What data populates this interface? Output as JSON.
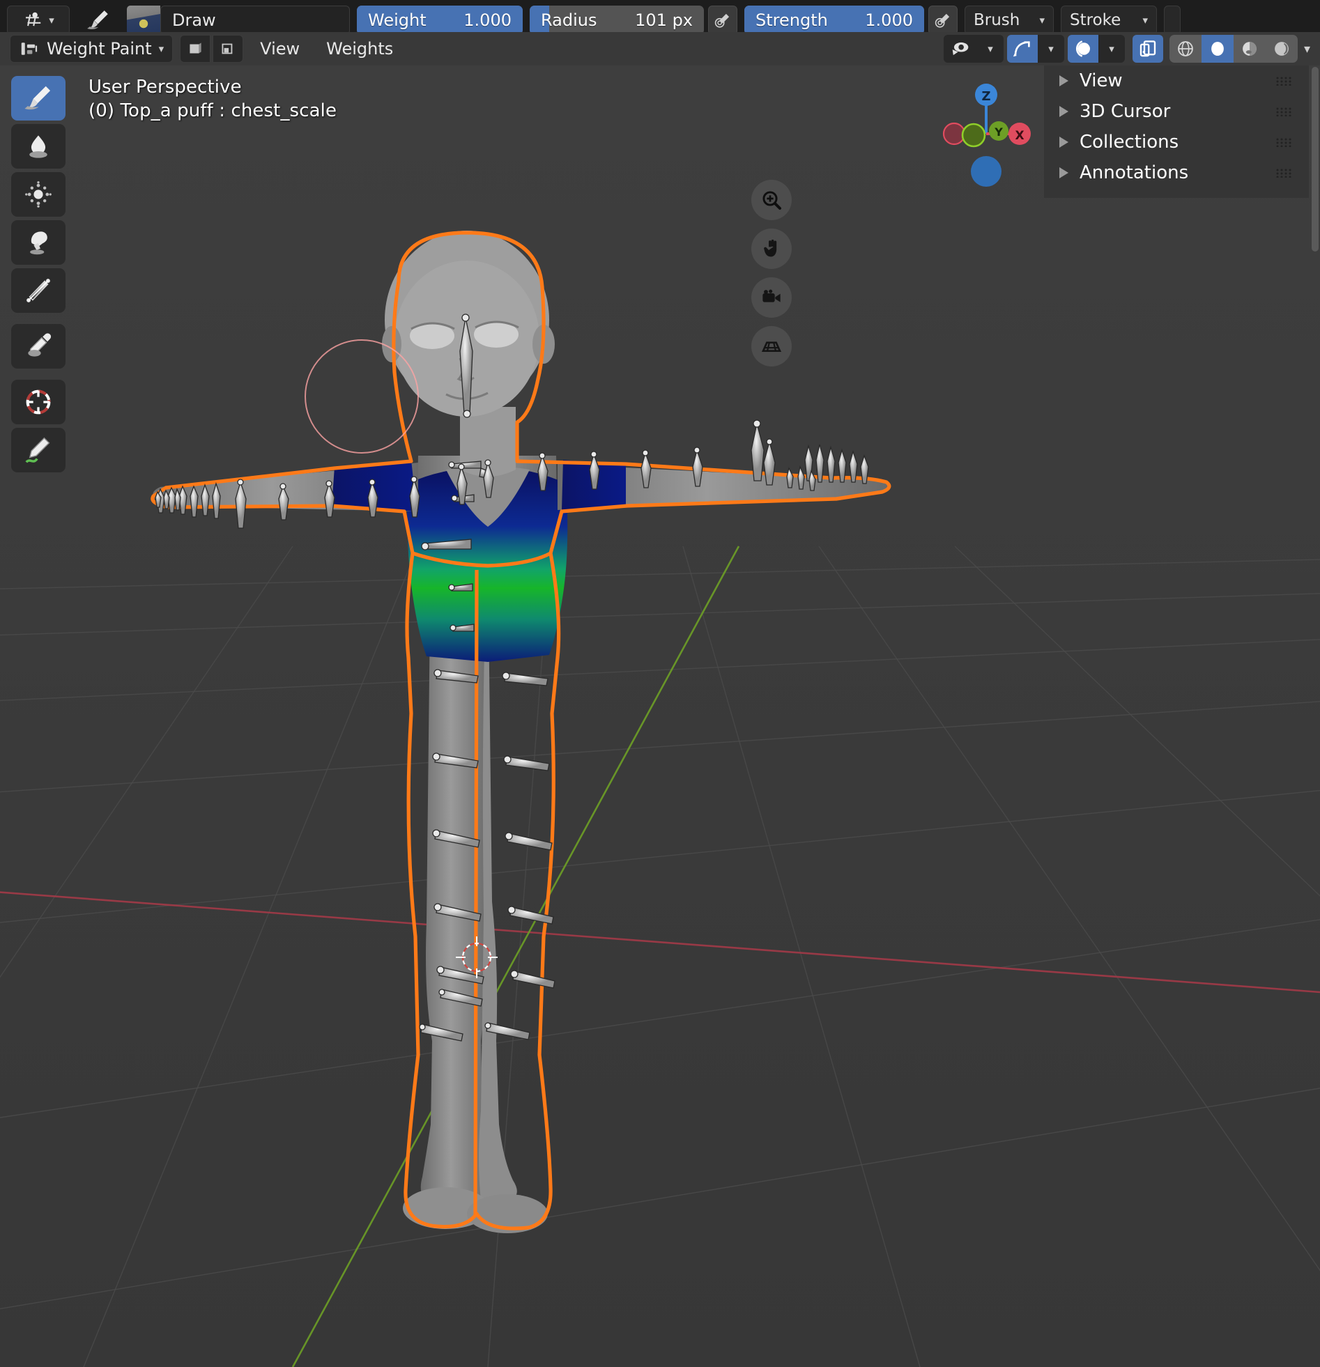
{
  "app": {
    "name": "Blender",
    "editor": "3D Viewport"
  },
  "tool_settings": {
    "falloff_icon": "brush-falloff-icon",
    "brush_icon": "brush-icon",
    "brush_preview_icon": "brush-preview-thumbnail",
    "brush_name": "Draw",
    "weight": {
      "label": "Weight",
      "value": "1.000",
      "fill_percent": 100
    },
    "radius": {
      "label": "Radius",
      "value": "101 px",
      "fill_percent": 11
    },
    "strength": {
      "label": "Strength",
      "value": "1.000",
      "fill_percent": 100
    },
    "radius_pressure_icon": "pressure-sensitivity-icon",
    "strength_pressure_icon": "pressure-sensitivity-icon",
    "brush_menu": "Brush",
    "stroke_menu": "Stroke"
  },
  "header": {
    "mode_icon": "weight-paint-mode-icon",
    "mode": "Weight Paint",
    "toggle_vertex_selection_icon": "vertex-selection-masking-icon",
    "toggle_face_selection_icon": "face-selection-masking-icon",
    "menus": [
      "View",
      "Weights"
    ],
    "right_icons": [
      {
        "name": "visibility-icon",
        "glyph": "eye",
        "active": false,
        "has_dropdown": true
      },
      {
        "name": "snap-magnet-icon",
        "glyph": "snap",
        "active": true,
        "has_dropdown": true
      },
      {
        "name": "proportional-editing-icon",
        "glyph": "proportional",
        "active": true,
        "has_dropdown": true
      },
      {
        "name": "show-overlays-icon",
        "glyph": "overlays",
        "active": true,
        "has_dropdown": false
      }
    ],
    "shading_modes": [
      {
        "name": "wireframe-shading-icon",
        "selected": false
      },
      {
        "name": "solid-shading-icon",
        "selected": true
      },
      {
        "name": "material-preview-shading-icon",
        "selected": false
      },
      {
        "name": "rendered-shading-icon",
        "selected": false
      }
    ],
    "overflow_icon": "header-overflow-chevron-icon"
  },
  "toolbar": {
    "tools": [
      {
        "name": "tool-draw",
        "label": "Draw",
        "icon": "paintbrush-icon",
        "active": true
      },
      {
        "name": "tool-blur",
        "label": "Blur",
        "icon": "droplet-icon",
        "active": false
      },
      {
        "name": "tool-average",
        "label": "Average",
        "icon": "average-dots-icon",
        "active": false
      },
      {
        "name": "tool-smear",
        "label": "Smear",
        "icon": "smear-hand-icon",
        "active": false
      },
      {
        "name": "tool-gradient",
        "label": "Gradient",
        "icon": "gradient-icon",
        "active": false
      },
      {
        "name": "tool-sample-weight",
        "label": "Sample Weight",
        "icon": "eyedropper-icon",
        "active": false
      },
      {
        "name": "tool-cursor",
        "label": "Cursor",
        "icon": "cursor-crosshair-icon",
        "active": false
      },
      {
        "name": "tool-annotate",
        "label": "Annotate",
        "icon": "annotate-pen-icon",
        "active": false
      }
    ]
  },
  "viewport": {
    "perspective_label": "User Perspective",
    "object_info": "(0) Top_a puff : chest_scale",
    "gizmo": {
      "axes": [
        {
          "name": "z-axis-positive",
          "label": "Z",
          "color": "#3b86d8",
          "filled": true
        },
        {
          "name": "y-axis-positive",
          "label": "Y",
          "color": "#6d9f26",
          "filled": true
        },
        {
          "name": "x-axis-positive",
          "label": "X",
          "color": "#e04c5f",
          "filled": true
        },
        {
          "name": "x-axis-negative",
          "label": "",
          "color": "#7c3540",
          "filled": false
        },
        {
          "name": "y-axis-negative",
          "label": "",
          "color": "#4d6b1a",
          "filled": false
        },
        {
          "name": "z-axis-negative",
          "label": "",
          "color": "#2b6aa8",
          "filled": false
        }
      ]
    },
    "nav_buttons": [
      {
        "name": "zoom-view-icon",
        "glyph": "magnifier"
      },
      {
        "name": "move-view-icon",
        "glyph": "hand"
      },
      {
        "name": "camera-view-icon",
        "glyph": "camera"
      },
      {
        "name": "toggle-perspective-orthographic-icon",
        "glyph": "grid"
      }
    ],
    "brush_cursor": {
      "name": "brush-radius-cursor",
      "radius_px": 101
    },
    "colors": {
      "object_outline": "#ff7a18",
      "weight_hot": "#d42a2a",
      "weight_mid": "#1fb31f",
      "weight_cold": "#0a1a80",
      "brush_cursor": "#ffa4a4",
      "grid_line": "#4a4a4a",
      "x_axis_line": "#a33b4a",
      "y_axis_line": "#5d8c1f",
      "accent_blue": "#4772b3",
      "background": "#3b3b3b"
    }
  },
  "side_panel": {
    "tabs_visible": false,
    "sections": [
      {
        "name": "panel-view",
        "label": "View",
        "expanded": false
      },
      {
        "name": "panel-3d-cursor",
        "label": "3D Cursor",
        "expanded": false
      },
      {
        "name": "panel-collections",
        "label": "Collections",
        "expanded": false
      },
      {
        "name": "panel-annotations",
        "label": "Annotations",
        "expanded": false
      }
    ]
  }
}
